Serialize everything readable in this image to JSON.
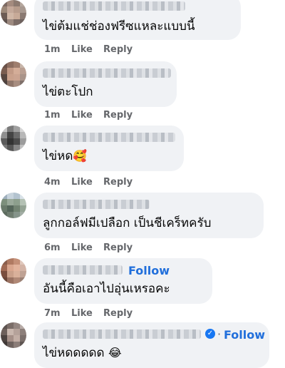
{
  "comments": [
    {
      "text": "ไข่ต้มแช่ช่องฟรีซแหละแบบนี้",
      "time": "1m",
      "like": "Like",
      "reply": "Reply"
    },
    {
      "text": "ไข่ตะโปก",
      "time": "1m",
      "like": "Like",
      "reply": "Reply"
    },
    {
      "text": "ไข่หด",
      "emoji": "🥰",
      "time": "4m",
      "like": "Like",
      "reply": "Reply"
    },
    {
      "text": "ลูกกอล์ฟมีเปลือก เป็นชีเคร็ทครับ",
      "time": "6m",
      "like": "Like",
      "reply": "Reply"
    },
    {
      "text": "อันนี้คือเอาไปอุ่นเหรอคะ",
      "follow": "Follow",
      "time": "7m",
      "like": "Like",
      "reply": "Reply"
    },
    {
      "text": "ไข่หดดดดด",
      "emoji": "😂",
      "follow": "Follow",
      "time": "",
      "like": "",
      "reply": ""
    }
  ],
  "colors": {
    "bubble": "#f0f2f5",
    "follow": "#216fdb",
    "meta": "#65676b",
    "verified": "#1877f2"
  }
}
